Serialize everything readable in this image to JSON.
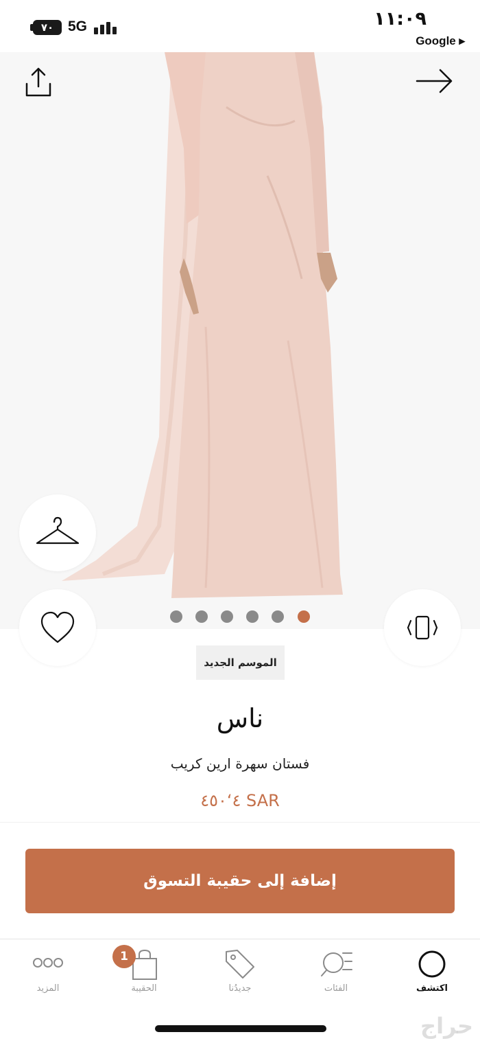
{
  "status_bar": {
    "battery": "٧٠",
    "network": "5G",
    "time": "١١:٠٩",
    "back_app": "Google ▸"
  },
  "image_carousel": {
    "page_count": 6,
    "active_index": 5
  },
  "product": {
    "badge": "الموسم الجديد",
    "brand": "ناس",
    "name": "فستان سهرة ارين كريب",
    "price": "٤‘٤٥٠ SAR"
  },
  "cta": {
    "label": "إضافة إلى حقيبة التسوق"
  },
  "tabs": [
    {
      "label": "اكتشف",
      "icon": "discover-icon",
      "active": true
    },
    {
      "label": "الفئات",
      "icon": "categories-icon",
      "active": false
    },
    {
      "label": "جديدُنا",
      "icon": "tag-icon",
      "active": false
    },
    {
      "label": "الحقيبة",
      "icon": "bag-icon",
      "active": false,
      "badge": "1"
    },
    {
      "label": "المزيد",
      "icon": "more-icon",
      "active": false
    }
  ],
  "watermark": "حراج",
  "colors": {
    "accent": "#c4704a",
    "dress": "#eed1c6",
    "dot_inactive": "#8a8a8a"
  }
}
